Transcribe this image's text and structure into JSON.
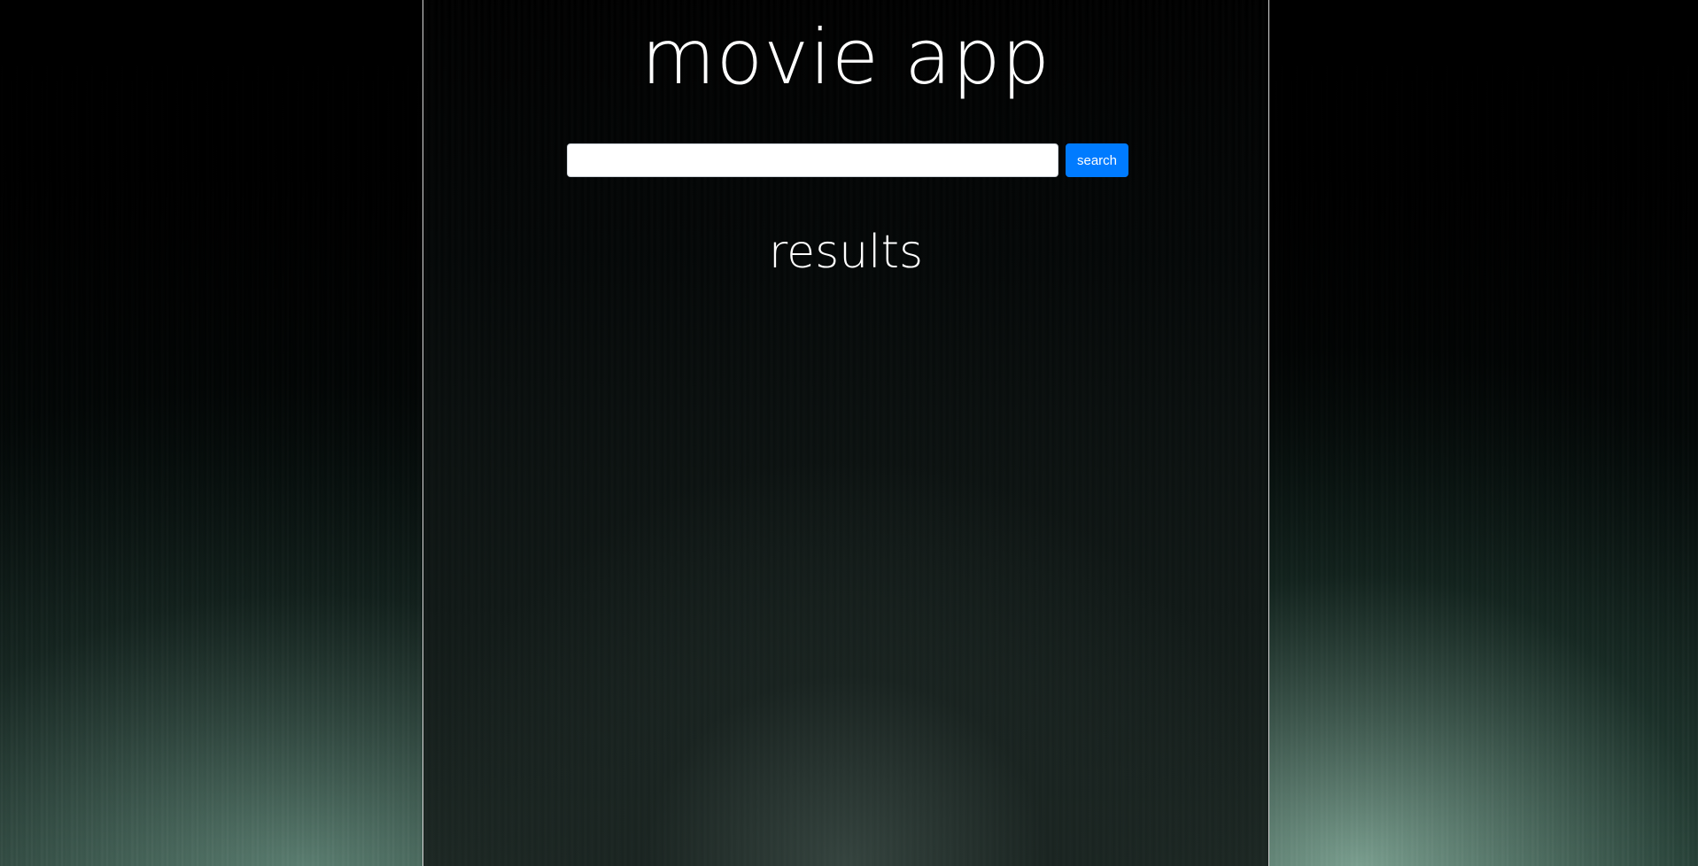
{
  "app": {
    "title": "movie app"
  },
  "search": {
    "value": "",
    "placeholder": "",
    "button_label": "search"
  },
  "results": {
    "heading": "results",
    "items": []
  },
  "colors": {
    "accent": "#007bff",
    "panel_border": "#d8d8d8",
    "text": "#ffffff"
  }
}
